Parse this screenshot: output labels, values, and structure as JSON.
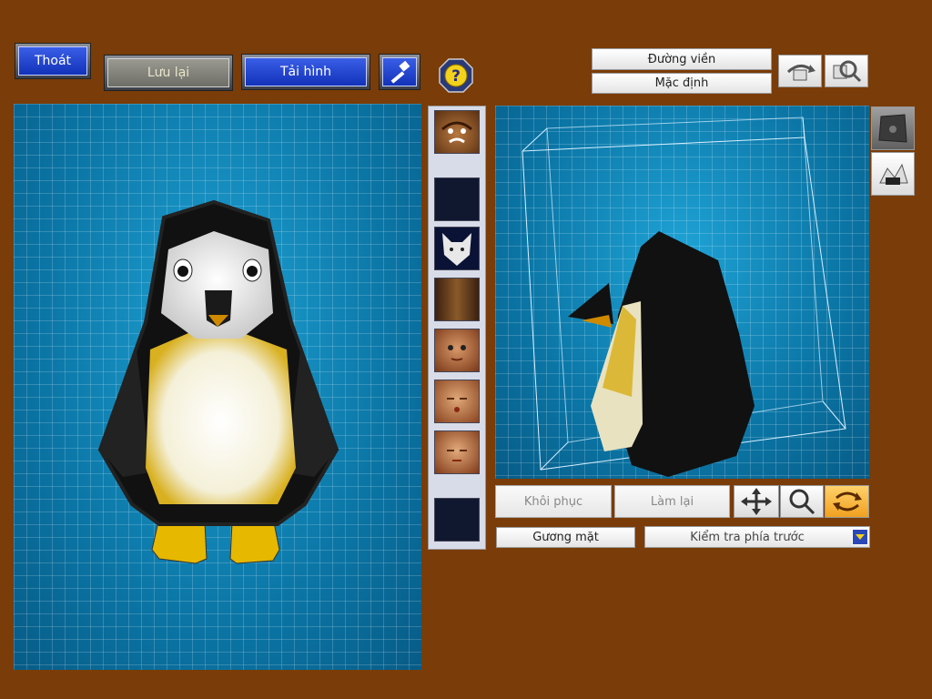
{
  "toolbar": {
    "exit_label": "Thoát",
    "save_label": "Lưu lại",
    "reload_label": "Tải hình",
    "hammer_icon": "hammer-icon",
    "help_icon": "help-icon"
  },
  "view_options": {
    "outline_label": "Đường viền",
    "default_label": "Mặc định"
  },
  "side_tools": {
    "rotate_icon": "rotate-view-icon",
    "zoom_icon": "zoom-view-icon",
    "background_icon": "background-icon",
    "effect_icon": "effect-icon"
  },
  "part_thumbnails": [
    {
      "name": "face-angry"
    },
    {
      "name": "empty-slot"
    },
    {
      "name": "wolf-head"
    },
    {
      "name": "hair-brown"
    },
    {
      "name": "face-round-1"
    },
    {
      "name": "face-round-2"
    },
    {
      "name": "face-round-3"
    },
    {
      "name": "empty-slot"
    }
  ],
  "controls": {
    "restore_label": "Khôi phục",
    "redo_label": "Làm lại",
    "move_icon": "move-icon",
    "magnify_icon": "magnify-icon",
    "orbit_icon": "orbit-icon",
    "face_label": "Gương mặt",
    "front_check_label": "Kiểm tra phía trước"
  },
  "colors": {
    "background": "#7a3c08",
    "grid_blue": "#0a7fb0",
    "button_blue": "#1e40d0"
  }
}
